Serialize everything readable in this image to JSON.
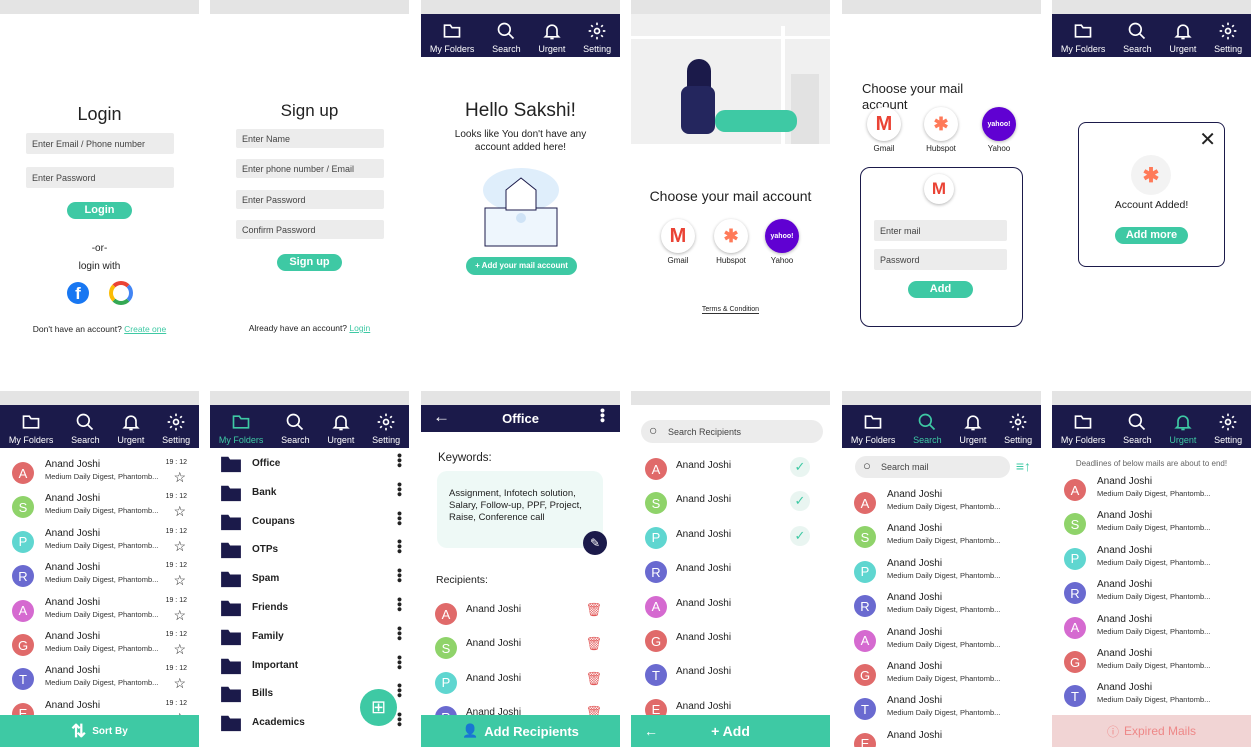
{
  "nav": {
    "folders": "My Folders",
    "search": "Search",
    "urgent": "Urgent",
    "setting": "Setting"
  },
  "login": {
    "title": "Login",
    "email_ph": "Enter Email / Phone number",
    "pass_ph": "Enter Password",
    "btn": "Login",
    "or": "-or-",
    "with": "login with",
    "no_account": "Don't have an account?",
    "create": "Create one"
  },
  "signup": {
    "title": "Sign up",
    "name_ph": "Enter Name",
    "phone_ph": "Enter phone number / Email",
    "pass_ph": "Enter Password",
    "confirm_ph": "Confirm Password",
    "btn": "Sign up",
    "have": "Already have an account?",
    "login": "Login"
  },
  "welcome": {
    "title": "Hello Sakshi!",
    "msg": "Looks like You don't have any account added here!",
    "btn": "+ Add your mail account"
  },
  "choose": {
    "title": "Choose your mail account",
    "terms": "Terms & Condition"
  },
  "providers": {
    "gmail": "Gmail",
    "hubspot": "Hubspot",
    "yahoo": "Yahoo"
  },
  "addform": {
    "title": "Choose your mail account",
    "email_ph": "Enter mail",
    "pass_ph": "Password",
    "btn": "Add"
  },
  "added": {
    "msg": "Account Added!",
    "btn": "Add more"
  },
  "mails": [
    {
      "initial": "A",
      "name": "Anand Joshi",
      "sub": "Medium Daily Digest, Phantomb...",
      "time": "19 : 12",
      "color": "#e06a6a"
    },
    {
      "initial": "S",
      "name": "Anand Joshi",
      "sub": "Medium Daily Digest, Phantomb...",
      "time": "19 : 12",
      "color": "#8fd36a"
    },
    {
      "initial": "P",
      "name": "Anand Joshi",
      "sub": "Medium Daily Digest, Phantomb...",
      "time": "19 : 12",
      "color": "#5fd6d0"
    },
    {
      "initial": "R",
      "name": "Anand Joshi",
      "sub": "Medium Daily Digest, Phantomb...",
      "time": "19 : 12",
      "color": "#6a6ad0"
    },
    {
      "initial": "A",
      "name": "Anand Joshi",
      "sub": "Medium Daily Digest, Phantomb...",
      "time": "19 : 12",
      "color": "#d56ad0"
    },
    {
      "initial": "G",
      "name": "Anand Joshi",
      "sub": "Medium Daily Digest, Phantomb...",
      "time": "19 : 12",
      "color": "#e06a6a"
    },
    {
      "initial": "T",
      "name": "Anand Joshi",
      "sub": "Medium Daily Digest, Phantomb...",
      "time": "19 : 12",
      "color": "#6a6ad0"
    },
    {
      "initial": "E",
      "name": "Anand Joshi",
      "sub": "",
      "time": "19 : 12",
      "color": "#e06a6a"
    }
  ],
  "sortby": "Sort By",
  "folders": [
    "Office",
    "Bank",
    "Coupans",
    "OTPs",
    "Spam",
    "Friends",
    "Family",
    "Important",
    "Bills",
    "Academics"
  ],
  "office": {
    "title": "Office",
    "kw_label": "Keywords:",
    "keywords": "Assignment, Infotech solution, Salary, Follow-up, PPF, Project, Raise, Conference call",
    "rec_label": "Recipients:",
    "add": "Add Recipients"
  },
  "recipients": {
    "search_ph": "Search Recipients",
    "add": "+ Add"
  },
  "searchmail": {
    "ph": "Search mail"
  },
  "urgent": {
    "note": "Deadlines of below mails are about to end!",
    "expired": "Expired Mails"
  }
}
